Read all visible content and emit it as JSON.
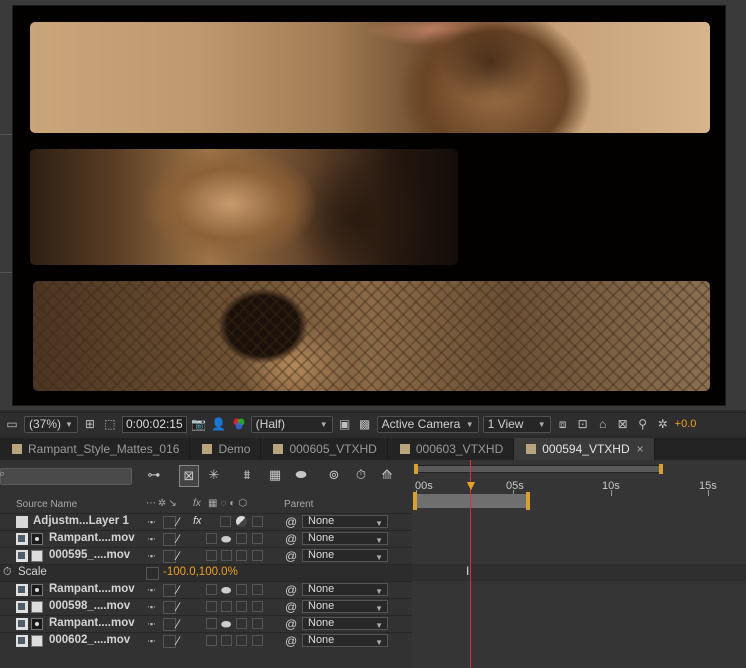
{
  "viewer": {
    "zoom": "(37%)",
    "timecode": "0:00:02:15",
    "resolution": "(Half)",
    "camera": "Active Camera",
    "view_layout": "1 View",
    "exposure": "+0.0"
  },
  "tabs": [
    {
      "label": "Rampant_Style_Mattes_016",
      "active": false
    },
    {
      "label": "Demo",
      "active": false
    },
    {
      "label": "000605_VTXHD",
      "active": false
    },
    {
      "label": "000603_VTXHD",
      "active": false
    },
    {
      "label": "000594_VTXHD",
      "active": true
    }
  ],
  "tab_close": "×",
  "timeline": {
    "columns": {
      "source_name": "Source Name",
      "parent": "Parent"
    },
    "ruler_ticks": [
      "00s",
      "05s",
      "10s",
      "15s"
    ],
    "layers": [
      {
        "name": "Adjustm...Layer 1",
        "parent": "None",
        "type": "adjustment"
      },
      {
        "name": "Rampant....mov",
        "parent": "None",
        "type": "matte"
      },
      {
        "name": "000595_....mov",
        "parent": "None",
        "type": "footage"
      },
      {
        "name": "Rampant....mov",
        "parent": "None",
        "type": "matte"
      },
      {
        "name": "000598_....mov",
        "parent": "None",
        "type": "footage"
      },
      {
        "name": "Rampant....mov",
        "parent": "None",
        "type": "matte"
      },
      {
        "name": "000602_....mov",
        "parent": "None",
        "type": "footage"
      }
    ],
    "property": {
      "name": "Scale",
      "value": "-100.0,100.0%"
    }
  },
  "colors": {
    "accent": "#f0a020",
    "adjustment_clip": "#7e7a99",
    "footage_clip": "#6f9590",
    "playhead": "#e03030"
  }
}
